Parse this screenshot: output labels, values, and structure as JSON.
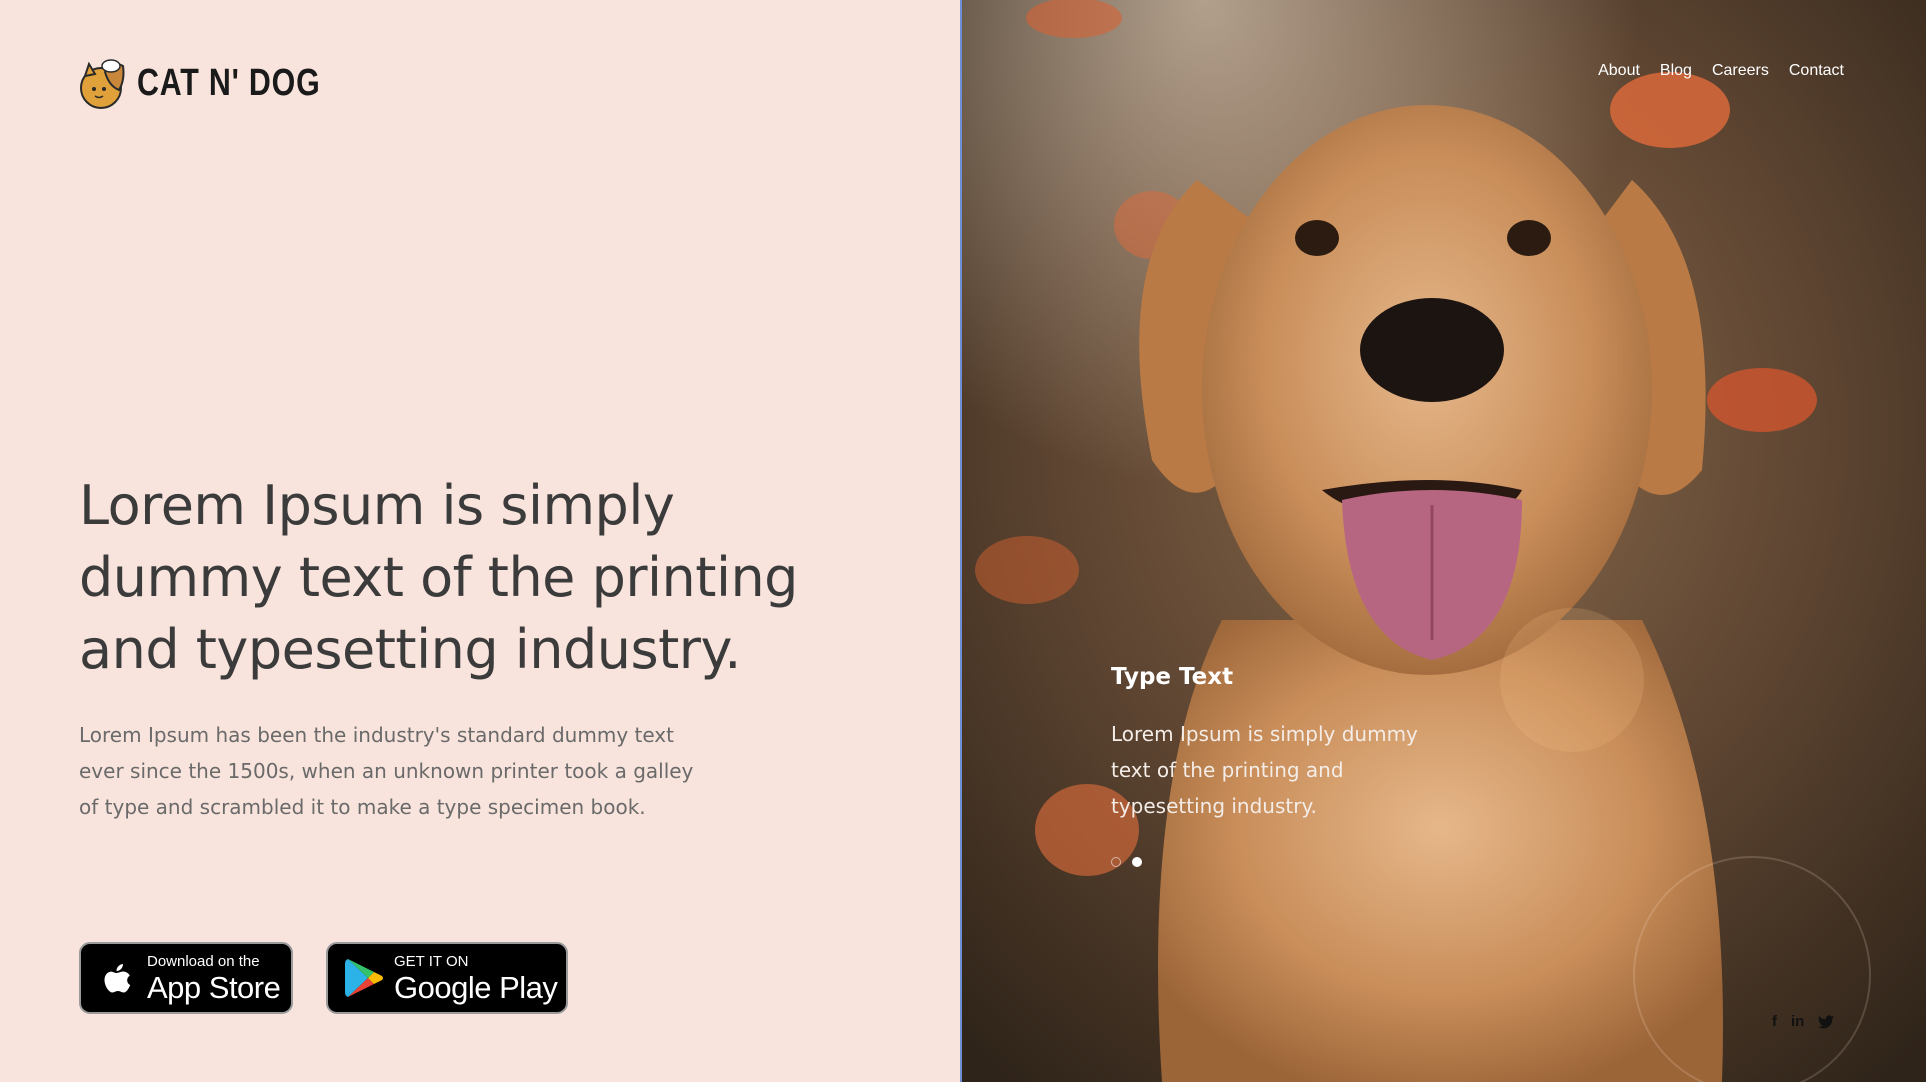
{
  "brand": {
    "name": "CAT N' DOG",
    "logo_icon": "cat-dog-logo-icon"
  },
  "hero": {
    "headline": "Lorem Ipsum is simply dummy text of the printing and typesetting industry.",
    "subtext": "Lorem Ipsum has been the industry's standard dummy text ever since the 1500s, when an unknown printer took a galley of type and scrambled it to make a type specimen book."
  },
  "store_buttons": {
    "apple": {
      "small": "Download on the",
      "large": "App Store",
      "icon": "apple-icon"
    },
    "google": {
      "small": "GET IT ON",
      "large": "Google Play",
      "icon": "google-play-icon"
    }
  },
  "nav": {
    "items": [
      {
        "label": "About"
      },
      {
        "label": "Blog"
      },
      {
        "label": "Careers"
      },
      {
        "label": "Contact"
      }
    ]
  },
  "slide": {
    "title": "Type Text",
    "body": "Lorem Ipsum is simply dummy text of the printing and typesetting industry.",
    "current_index": 2,
    "total": 2
  },
  "social": {
    "facebook": "f",
    "linkedin": "in",
    "twitter_icon": "twitter-icon"
  },
  "colors": {
    "left_background": "#f8e4dc",
    "headline": "#3b3b3b",
    "body_text": "#6a6a6a",
    "divider": "#6d8fd6"
  }
}
